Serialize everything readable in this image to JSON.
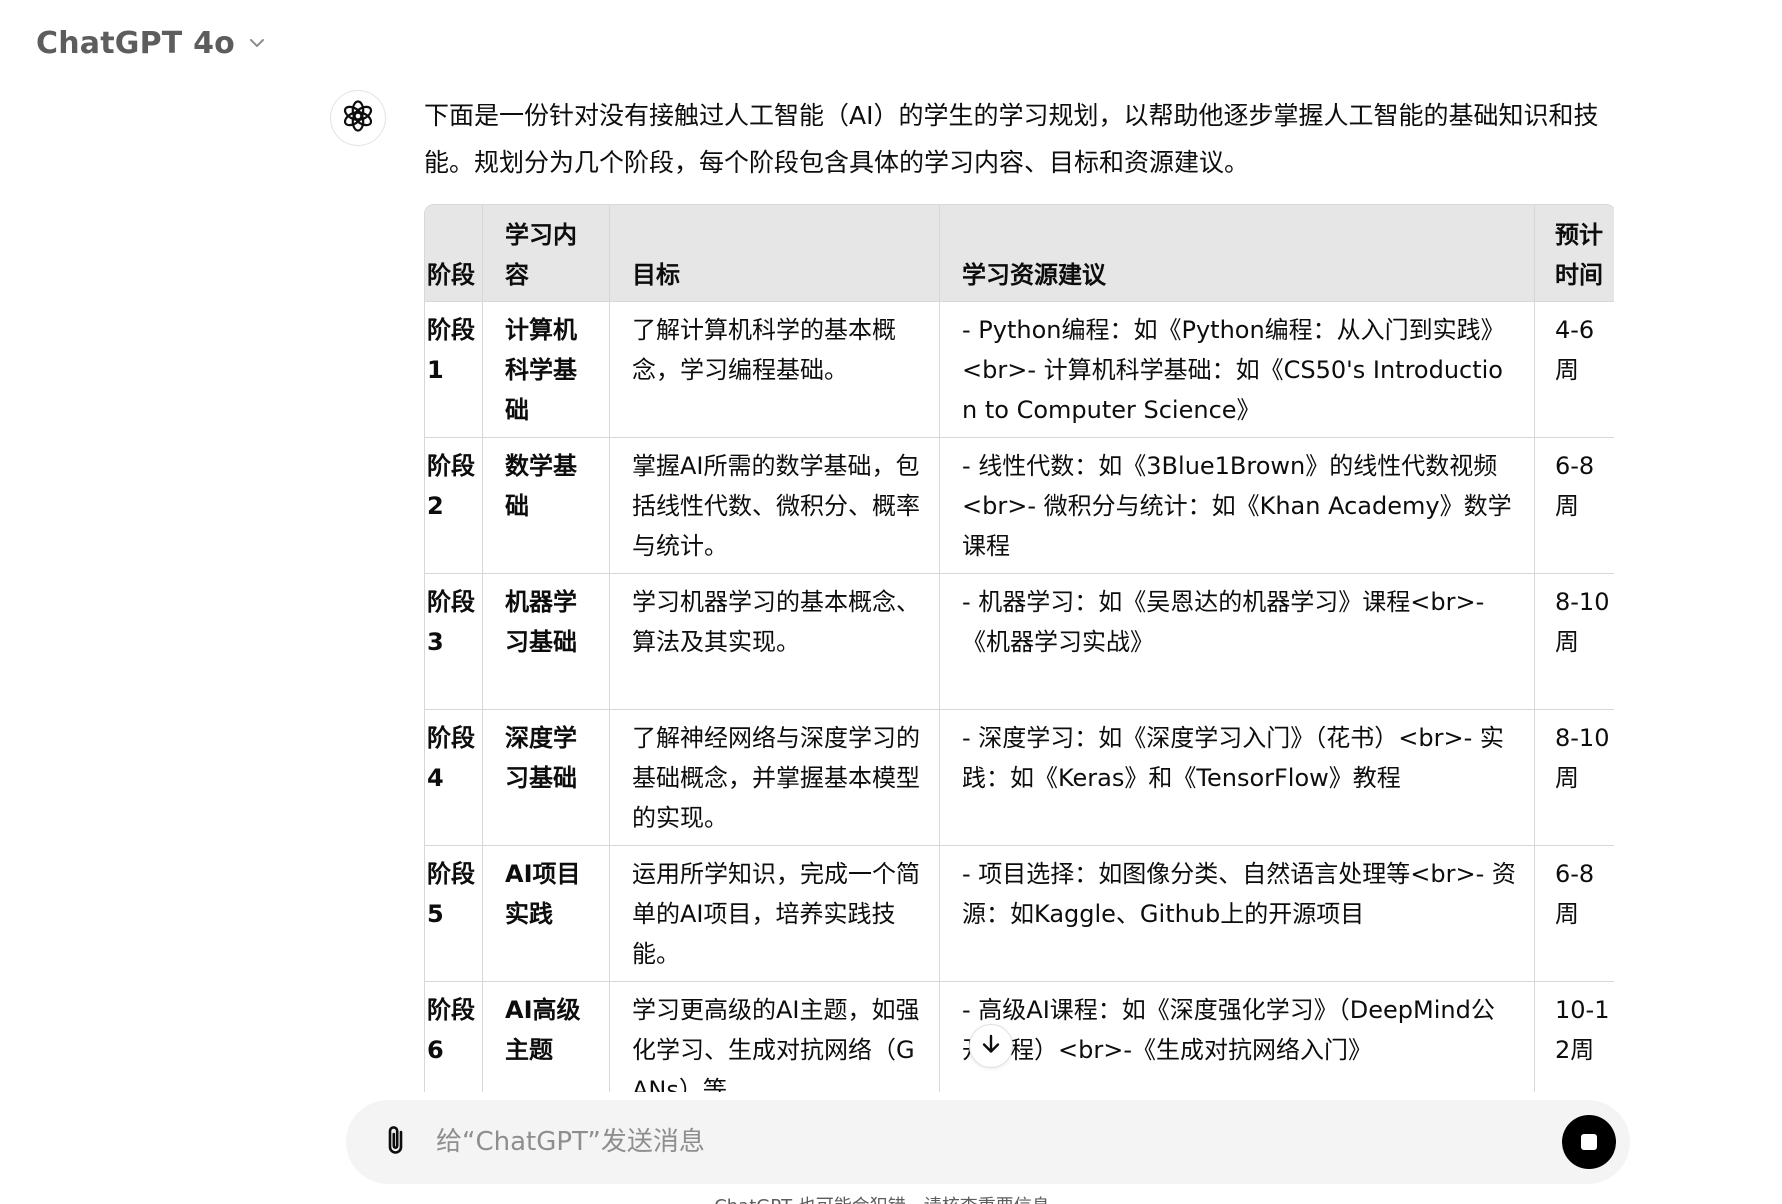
{
  "header": {
    "model_name": "ChatGPT 4o",
    "chevron_icon": "chevron-down-icon"
  },
  "assistant": {
    "avatar_icon": "openai-logo-icon",
    "intro": "下面是一份针对没有接触过人工智能（AI）的学生的学习规划，以帮助他逐步掌握人工智能的基础知识和技能。规划分为几个阶段，每个阶段包含具体的学习内容、目标和资源建议。",
    "table": {
      "headers": [
        "阶段",
        "学习内容",
        "目标",
        "学习资源建议",
        "预计时间"
      ],
      "rows": [
        [
          "阶段1",
          "计算机科学基础",
          "了解计算机科学的基本概念，学习编程基础。",
          "- Python编程：如《Python编程：从入门到实践》<br>- 计算机科学基础：如《CS50's Introduction to Computer Science》",
          "4-6周"
        ],
        [
          "阶段2",
          "数学基础",
          "掌握AI所需的数学基础，包括线性代数、微积分、概率与统计。",
          "- 线性代数：如《3Blue1Brown》的线性代数视频<br>- 微积分与统计：如《Khan Academy》数学课程",
          "6-8周"
        ],
        [
          "阶段3",
          "机器学习基础",
          "学习机器学习的基本概念、算法及其实现。",
          "- 机器学习：如《吴恩达的机器学习》课程<br>-《机器学习实战》",
          "8-10周"
        ],
        [
          "阶段4",
          "深度学习基础",
          "了解神经网络与深度学习的基础概念，并掌握基本模型的实现。",
          "- 深度学习：如《深度学习入门》（花书）<br>- 实践：如《Keras》和《TensorFlow》教程",
          "8-10周"
        ],
        [
          "阶段5",
          "AI项目实践",
          "运用所学知识，完成一个简单的AI项目，培养实践技能。",
          "- 项目选择：如图像分类、自然语言处理等<br>- 资源：如Kaggle、Github上的开源项目",
          "6-8周"
        ],
        [
          "阶段6",
          "AI高级主题",
          "学习更高级的AI主题，如强化学习、生成对抗网络（GANs）等。",
          "- 高级AI课程：如《深度强化学习》（DeepMind公开课程）<br>-《生成对抗网络入门》",
          "10-12周"
        ]
      ]
    }
  },
  "composer": {
    "attach_icon": "paperclip-icon",
    "placeholder": "给“ChatGPT”发送消息",
    "stop_icon": "stop-icon"
  },
  "scroll_icon": "arrow-down-icon",
  "footnote": "ChatGPT 也可能会犯错。请核查重要信息。"
}
